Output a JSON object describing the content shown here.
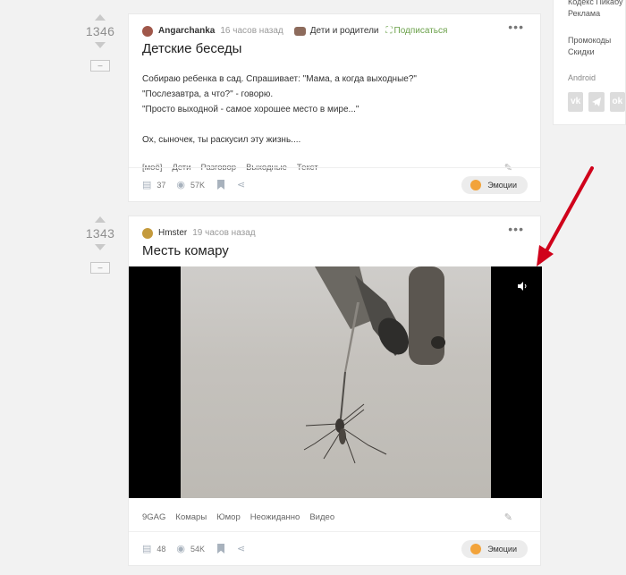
{
  "sidebar": {
    "links_top": [
      "Кодекс Пикабу",
      "Реклама"
    ],
    "links_mid": [
      "Промокоды",
      "Скидки"
    ],
    "android_label": "Android",
    "socials": [
      "vk",
      "telegram",
      "odnoklassniki"
    ]
  },
  "posts": [
    {
      "rating": "1346",
      "author": "Angarchanka",
      "time": "16 часов назад",
      "community": "Дети и родители",
      "subscribe": "Подписаться",
      "title": "Детские беседы",
      "body": [
        "Собираю ребенка в сад. Спрашивает: \"Мама, а когда выходные?\"",
        "\"Послезавтра, а что?\" - говорю.",
        "\"Просто выходной - самое хорошее место в мире...\"",
        "",
        "Ох, сыночек, ты раскусил эту жизнь...."
      ],
      "tags": [
        "[моё]",
        "Дети",
        "Разговор",
        "Выходные",
        "Текст"
      ],
      "comments": "37",
      "views": "57K",
      "emotions_label": "Эмоции"
    },
    {
      "rating": "1343",
      "author": "Hmster",
      "time": "19 часов назад",
      "title": "Месть комару",
      "tags": [
        "9GAG",
        "Комары",
        "Юмор",
        "Неожиданно",
        "Видео"
      ],
      "comments": "48",
      "views": "54K",
      "emotions_label": "Эмоции"
    }
  ],
  "minimize_label": "–",
  "icons": {
    "menu": "more-dots-icon",
    "edit": "pencil-icon",
    "comments": "comment-icon",
    "views": "eye-icon",
    "bookmark": "bookmark-icon",
    "share": "share-icon",
    "volume": "volume-icon",
    "annotation": "red-arrow"
  },
  "colors": {
    "subscribe": "#6ba14a",
    "annotation_arrow": "#d0021b"
  }
}
